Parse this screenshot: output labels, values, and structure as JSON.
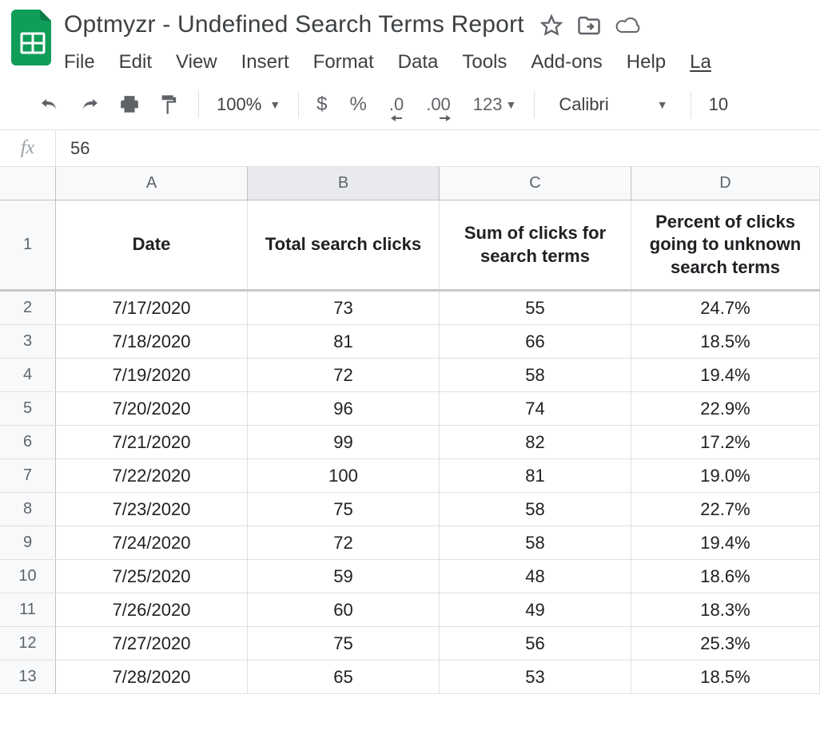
{
  "doc": {
    "title": "Optmyzr - Undefined Search Terms Report"
  },
  "menu": {
    "file": "File",
    "edit": "Edit",
    "view": "View",
    "insert": "Insert",
    "format": "Format",
    "data": "Data",
    "tools": "Tools",
    "addons": "Add-ons",
    "help": "Help",
    "last": "La"
  },
  "toolbar": {
    "zoom": "100%",
    "currency": "$",
    "percent": "%",
    "dec_less": ".0",
    "dec_more": ".00",
    "more_formats": "123",
    "font": "Calibri",
    "font_size": "10"
  },
  "formula": {
    "fx": "fx",
    "value": "56"
  },
  "columns": {
    "A": "A",
    "B": "B",
    "C": "C",
    "D": "D"
  },
  "headers": {
    "A": "Date",
    "B": "Total search clicks",
    "C": "Sum of clicks for search terms",
    "D": "Percent of clicks going to unknown search terms"
  },
  "row_nums": [
    "1",
    "2",
    "3",
    "4",
    "5",
    "6",
    "7",
    "8",
    "9",
    "10",
    "11",
    "12",
    "13"
  ],
  "rows": [
    {
      "A": "7/17/2020",
      "B": "73",
      "C": "55",
      "D": "24.7%"
    },
    {
      "A": "7/18/2020",
      "B": "81",
      "C": "66",
      "D": "18.5%"
    },
    {
      "A": "7/19/2020",
      "B": "72",
      "C": "58",
      "D": "19.4%"
    },
    {
      "A": "7/20/2020",
      "B": "96",
      "C": "74",
      "D": "22.9%"
    },
    {
      "A": "7/21/2020",
      "B": "99",
      "C": "82",
      "D": "17.2%"
    },
    {
      "A": "7/22/2020",
      "B": "100",
      "C": "81",
      "D": "19.0%"
    },
    {
      "A": "7/23/2020",
      "B": "75",
      "C": "58",
      "D": "22.7%"
    },
    {
      "A": "7/24/2020",
      "B": "72",
      "C": "58",
      "D": "19.4%"
    },
    {
      "A": "7/25/2020",
      "B": "59",
      "C": "48",
      "D": "18.6%"
    },
    {
      "A": "7/26/2020",
      "B": "60",
      "C": "49",
      "D": "18.3%"
    },
    {
      "A": "7/27/2020",
      "B": "75",
      "C": "56",
      "D": "25.3%"
    },
    {
      "A": "7/28/2020",
      "B": "65",
      "C": "53",
      "D": "18.5%"
    }
  ]
}
